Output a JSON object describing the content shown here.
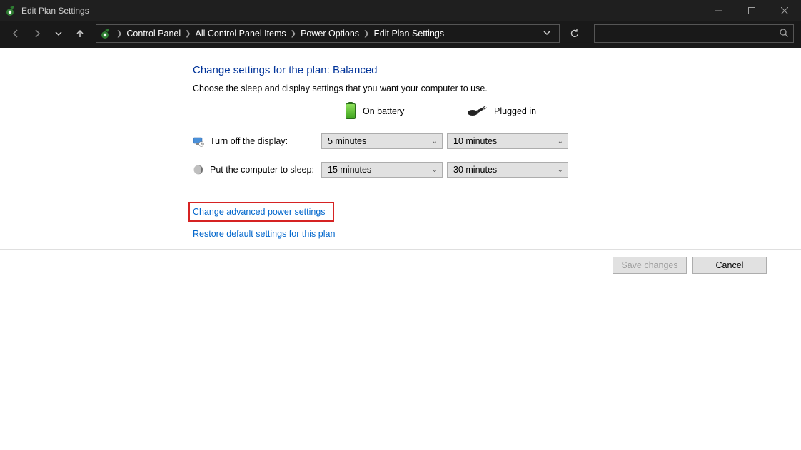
{
  "window": {
    "title": "Edit Plan Settings"
  },
  "breadcrumb": {
    "items": [
      "Control Panel",
      "All Control Panel Items",
      "Power Options",
      "Edit Plan Settings"
    ]
  },
  "main": {
    "heading": "Change settings for the plan: Balanced",
    "description": "Choose the sleep and display settings that you want your computer to use.",
    "col_battery": "On battery",
    "col_plugged": "Plugged in",
    "rows": [
      {
        "label": "Turn off the display:",
        "battery": "5 minutes",
        "plugged": "10 minutes"
      },
      {
        "label": "Put the computer to sleep:",
        "battery": "15 minutes",
        "plugged": "30 minutes"
      }
    ],
    "link_advanced": "Change advanced power settings",
    "link_restore": "Restore default settings for this plan"
  },
  "footer": {
    "save": "Save changes",
    "cancel": "Cancel"
  }
}
